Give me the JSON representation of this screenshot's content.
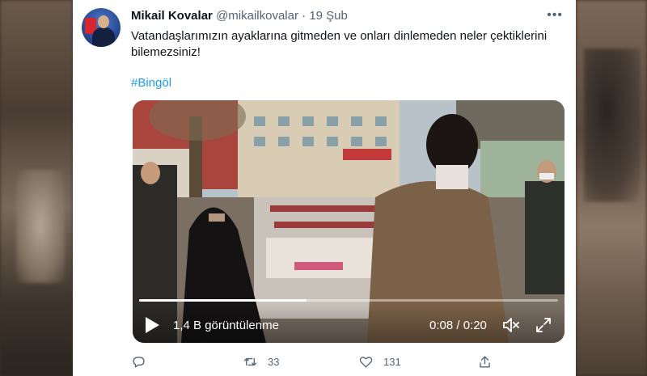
{
  "tweet": {
    "author_name": "Mikail Kovalar",
    "handle": "@mikailkovalar",
    "separator": "·",
    "date": "19 Şub",
    "more_icon": "more-horizontal-icon",
    "text": "Vatandaşlarımızın ayaklarına gitmeden ve onları dinlemeden neler çektiklerini bilemezsiniz!",
    "hashtag": "#Bingöl"
  },
  "video": {
    "views_label": "1,4 B görüntülenme",
    "time_label": "0:08 / 0:20",
    "progress": 0.4,
    "play_icon": "play-icon",
    "volume_icon": "volume-icon",
    "fullscreen_icon": "fullscreen-icon"
  },
  "actions": {
    "reply_icon": "reply-icon",
    "reply_count": "",
    "retweet_icon": "retweet-icon",
    "retweet_count": "33",
    "like_icon": "heart-icon",
    "like_count": "131",
    "share_icon": "share-icon"
  },
  "colors": {
    "link": "#1d9bf0",
    "text_primary": "#0f1419",
    "text_secondary": "#536471"
  }
}
